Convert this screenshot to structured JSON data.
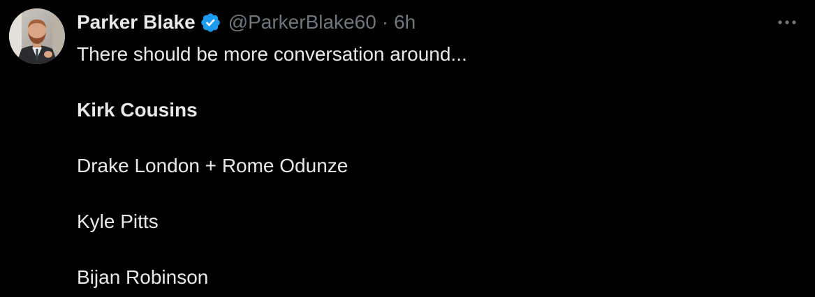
{
  "tweet": {
    "author": {
      "display_name": "Parker Blake",
      "handle": "@ParkerBlake60",
      "verified": true
    },
    "separator": "·",
    "time": "6h",
    "lines": [
      "There should be more conversation around...",
      "Kirk Cousins",
      "Drake London + Rome Odunze",
      "Kyle Pitts",
      "Bijan Robinson"
    ],
    "more_icon": "more-horizontal-icon",
    "verified_icon": "verified-badge-icon"
  },
  "colors": {
    "background": "#000000",
    "primary_text": "#e7e9ea",
    "secondary_text": "#71767b",
    "verified_blue": "#1d9bf0"
  }
}
